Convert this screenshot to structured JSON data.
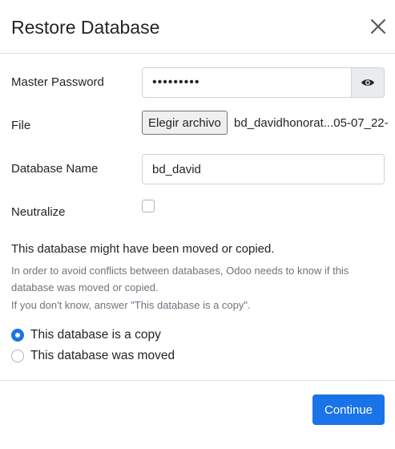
{
  "dialog": {
    "title": "Restore Database",
    "close_icon": "close-icon"
  },
  "form": {
    "master_password": {
      "label": "Master Password",
      "value": "•••••••••",
      "toggle_icon": "eye-icon"
    },
    "file": {
      "label": "File",
      "button_label": "Elegir archivo",
      "file_name": "bd_davidhonorat...05-07_22-"
    },
    "database_name": {
      "label": "Database Name",
      "value": "bd_david"
    },
    "neutralize": {
      "label": "Neutralize",
      "checked": false
    }
  },
  "notice": {
    "title": "This database might have been moved or copied.",
    "line1": "In order to avoid conflicts between databases, Odoo needs to know if this",
    "line2": "database was moved or copied.",
    "line3": "If you don't know, answer \"This database is a copy\"."
  },
  "options": [
    {
      "label": "This database is a copy",
      "checked": true
    },
    {
      "label": "This database was moved",
      "checked": false
    }
  ],
  "footer": {
    "continue_label": "Continue"
  },
  "colors": {
    "primary": "#1a73e8",
    "muted_text": "#6c757d",
    "border": "#dee2e6"
  }
}
